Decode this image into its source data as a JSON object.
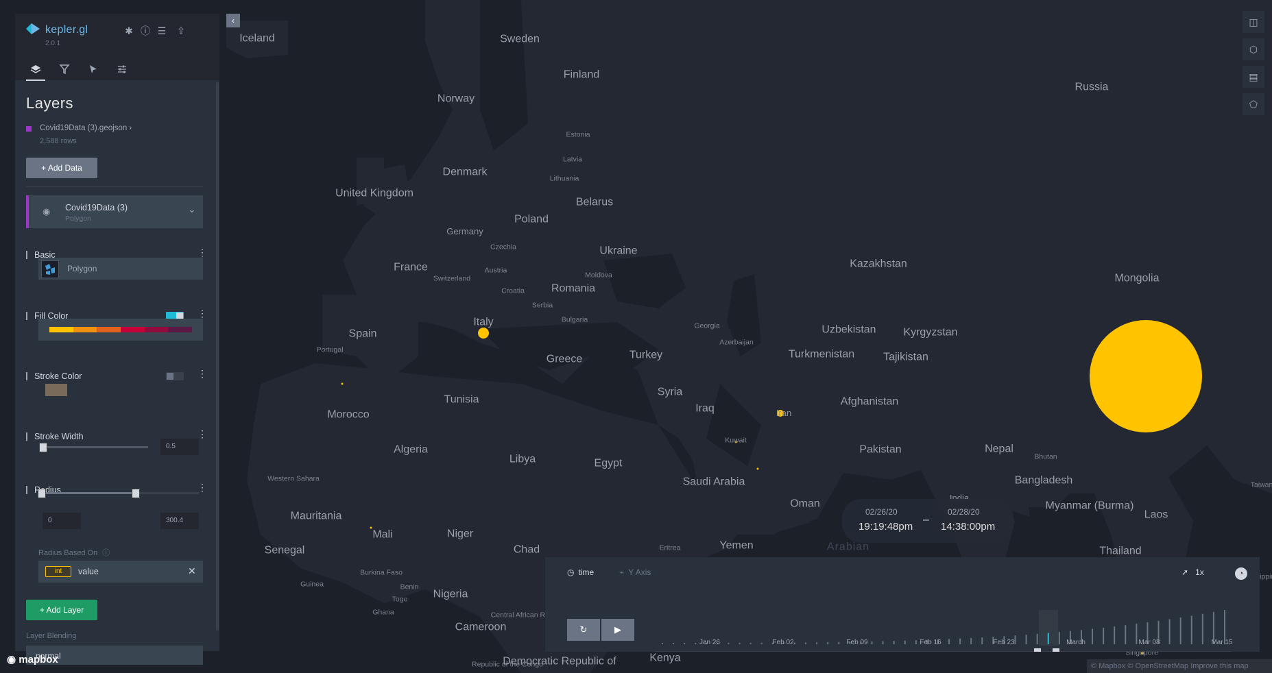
{
  "app": {
    "name": "kepler.gl",
    "version": "2.0.1"
  },
  "panel": {
    "title": "Layers",
    "dataset": {
      "name": "Covid19Data (3).geojson",
      "rows": "2,588 rows"
    },
    "add_data_label": "Add Data",
    "layer": {
      "name": "Covid19Data (3)",
      "type": "Polygon"
    },
    "sections": {
      "basic": "Basic",
      "basic_value": "Polygon",
      "fill_color": "Fill Color",
      "stroke_color": "Stroke Color",
      "stroke_width": "Stroke Width",
      "stroke_width_value": "0.5",
      "radius": "Radius",
      "radius_min": "0",
      "radius_max": "300.4",
      "radius_based_on": "Radius Based On",
      "radius_field_type": "int",
      "radius_field": "value"
    },
    "add_layer_label": "Add Layer",
    "blending_label": "Layer Blending",
    "blending_value": "normal",
    "fill_palette": [
      "#ffc300",
      "#f1920e",
      "#e3611c",
      "#c70039",
      "#900c3f",
      "#5a1846"
    ],
    "stroke_swatch": "#7a6a5a"
  },
  "map": {
    "countries": [
      {
        "t": "Iceland"
      },
      {
        "t": "Sweden"
      },
      {
        "t": "Finland"
      },
      {
        "t": "Norway"
      },
      {
        "t": "Russia"
      },
      {
        "t": "Estonia"
      },
      {
        "t": "Latvia"
      },
      {
        "t": "Lithuania"
      },
      {
        "t": "Denmark"
      },
      {
        "t": "United Kingdom"
      },
      {
        "t": "Belarus"
      },
      {
        "t": "Germany"
      },
      {
        "t": "Poland"
      },
      {
        "t": "Czechia"
      },
      {
        "t": "Ukraine"
      },
      {
        "t": "Kazakhstan"
      },
      {
        "t": "France"
      },
      {
        "t": "Austria"
      },
      {
        "t": "Switzerland"
      },
      {
        "t": "Moldova"
      },
      {
        "t": "Croatia"
      },
      {
        "t": "Romania"
      },
      {
        "t": "Mongolia"
      },
      {
        "t": "Serbia"
      },
      {
        "t": "Italy"
      },
      {
        "t": "Bulgaria"
      },
      {
        "t": "Georgia"
      },
      {
        "t": "Uzbekistan"
      },
      {
        "t": "Kyrgyzstan"
      },
      {
        "t": "Spain"
      },
      {
        "t": "Azerbaijan"
      },
      {
        "t": "Portugal"
      },
      {
        "t": "Turkey"
      },
      {
        "t": "Turkmenistan"
      },
      {
        "t": "Tajikistan"
      },
      {
        "t": "Greece"
      },
      {
        "t": "Tunisia"
      },
      {
        "t": "Syria"
      },
      {
        "t": "Afghanistan"
      },
      {
        "t": "Iraq"
      },
      {
        "t": "Iran"
      },
      {
        "t": "Morocco"
      },
      {
        "t": "Kuwait"
      },
      {
        "t": "Algeria"
      },
      {
        "t": "Libya"
      },
      {
        "t": "Egypt"
      },
      {
        "t": "Pakistan"
      },
      {
        "t": "Nepal"
      },
      {
        "t": "Bhutan"
      },
      {
        "t": "Western Sahara"
      },
      {
        "t": "Saudi Arabia"
      },
      {
        "t": "Bangladesh"
      },
      {
        "t": "India"
      },
      {
        "t": "Myanmar (Burma)"
      },
      {
        "t": "Oman"
      },
      {
        "t": "Mauritania"
      },
      {
        "t": "Laos"
      },
      {
        "t": "Mali"
      },
      {
        "t": "Niger"
      },
      {
        "t": "Chad"
      },
      {
        "t": "Yemen"
      },
      {
        "t": "Senegal"
      },
      {
        "t": "Eritrea"
      },
      {
        "t": "Thailand"
      },
      {
        "t": "Burkina Faso"
      },
      {
        "t": "Guinea"
      },
      {
        "t": "Benin"
      },
      {
        "t": "Nigeria"
      },
      {
        "t": "Togo"
      },
      {
        "t": "Ghana"
      },
      {
        "t": "Central African Republic"
      },
      {
        "t": "Cameroon"
      },
      {
        "t": "Republic of the Congo"
      },
      {
        "t": "Democratic Republic of"
      },
      {
        "t": "Kenya"
      },
      {
        "t": "Singapore"
      },
      {
        "t": "Taiwan"
      },
      {
        "t": "Philippines"
      },
      {
        "t": "Arabian"
      }
    ]
  },
  "time_label": {
    "start_date": "02/26/20",
    "start_time": "19:19:48pm",
    "sep": "–",
    "end_date": "02/28/20",
    "end_time": "14:38:00pm"
  },
  "time_panel": {
    "field": "time",
    "y_axis": "Y Axis",
    "speed": "1x",
    "ticks": [
      "Jan 26",
      "Feb 02",
      "Feb 09",
      "Feb 16",
      "Feb 23",
      "March",
      "Mar 08",
      "Mar 15"
    ]
  },
  "attribution": {
    "mapbox": "mapbox",
    "text": "© Mapbox © OpenStreetMap  Improve this map"
  }
}
